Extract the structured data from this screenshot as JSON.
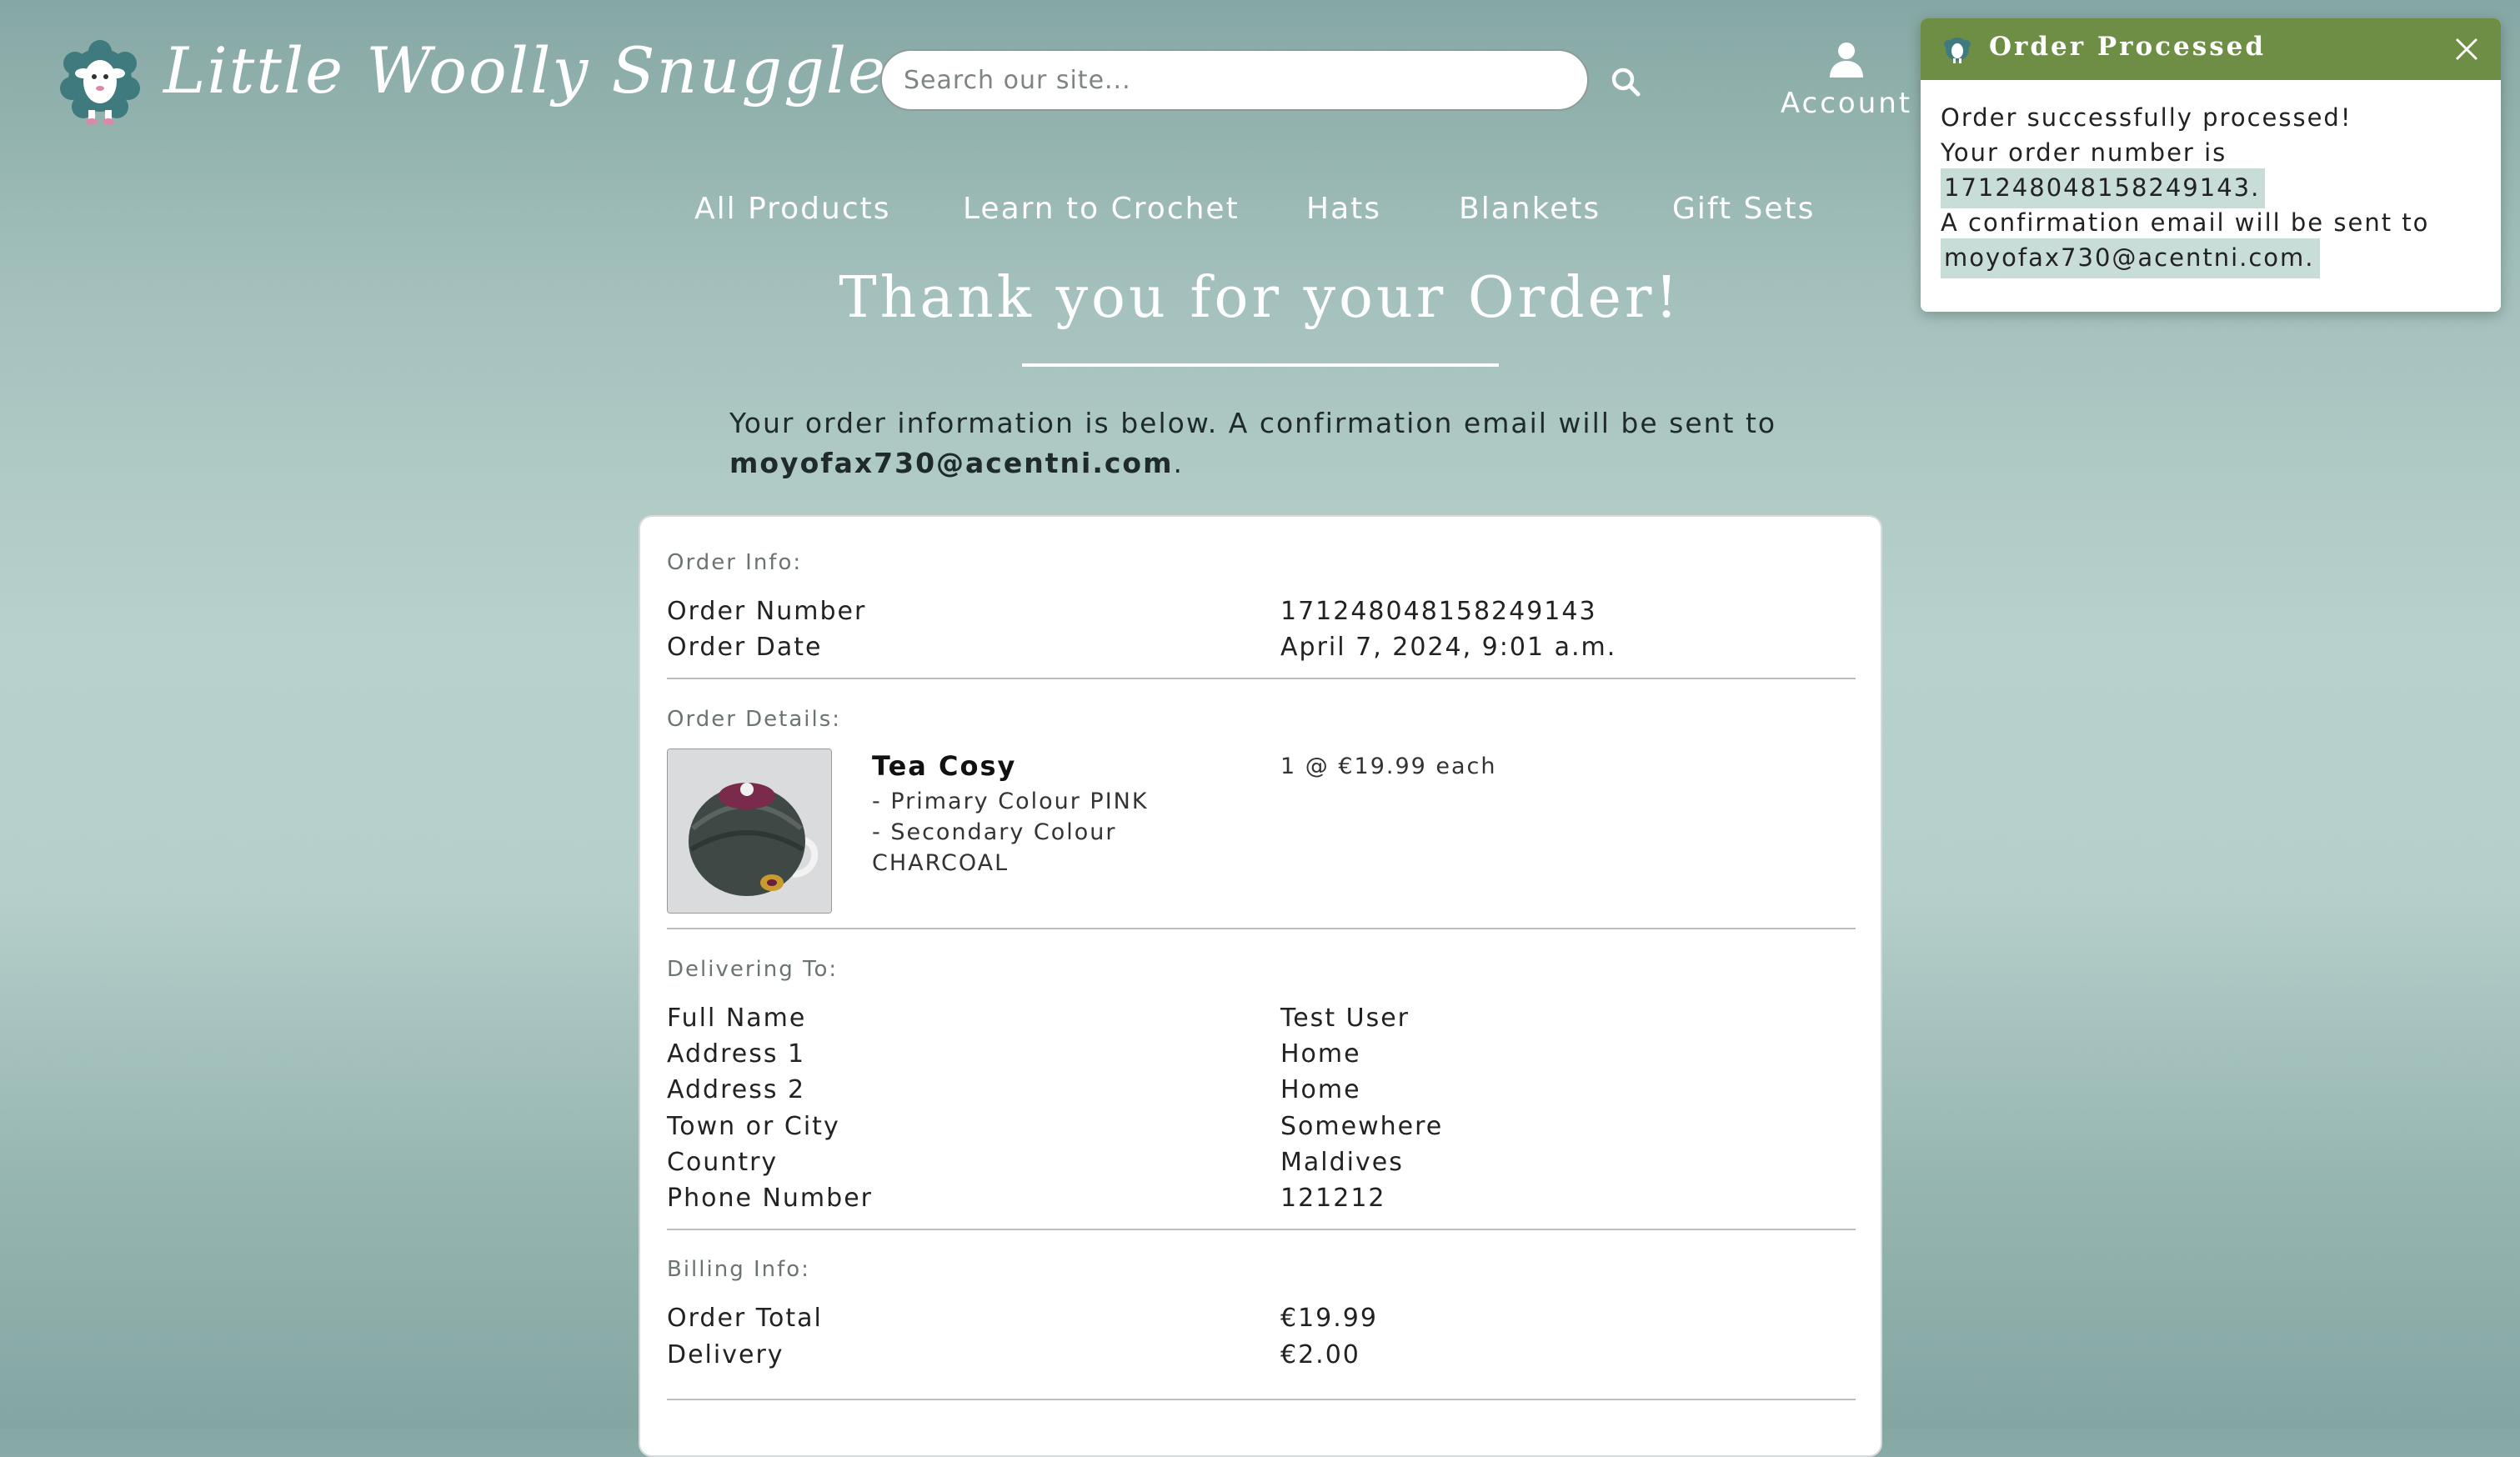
{
  "header": {
    "brand": "Little Woolly Snuggles",
    "search_placeholder": "Search our site...",
    "account_label": "Account"
  },
  "nav": {
    "items": [
      {
        "label": "All Products"
      },
      {
        "label": "Learn to Crochet"
      },
      {
        "label": "Hats"
      },
      {
        "label": "Blankets"
      },
      {
        "label": "Gift Sets"
      }
    ]
  },
  "page": {
    "title": "Thank you for your Order!",
    "intro_text": "Your order information is below. A confirmation email will be sent to",
    "intro_email": "moyofax730@acentni.com",
    "intro_period": "."
  },
  "order_info": {
    "heading": "Order Info:",
    "rows": [
      {
        "label": "Order Number",
        "value": "171248048158249143"
      },
      {
        "label": "Order Date",
        "value": "April 7, 2024, 9:01 a.m."
      }
    ]
  },
  "order_details": {
    "heading": "Order Details:",
    "item": {
      "name": "Tea Cosy",
      "attr1": "- Primary Colour PINK",
      "attr2": "- Secondary Colour",
      "attr3": "CHARCOAL",
      "qty_price": "1 @ €19.99 each"
    }
  },
  "delivering": {
    "heading": "Delivering To:",
    "rows": [
      {
        "label": "Full Name",
        "value": "Test User"
      },
      {
        "label": "Address 1",
        "value": "Home"
      },
      {
        "label": "Address 2",
        "value": "Home"
      },
      {
        "label": "Town or City",
        "value": "Somewhere"
      },
      {
        "label": "Country",
        "value": "Maldives"
      },
      {
        "label": "Phone Number",
        "value": "121212"
      }
    ]
  },
  "billing": {
    "heading": "Billing Info:",
    "rows": [
      {
        "label": "Order Total",
        "value": "€19.99"
      },
      {
        "label": "Delivery",
        "value": "€2.00"
      }
    ]
  },
  "toast": {
    "title": "Order Processed",
    "line1": "Order successfully processed!",
    "line2": "Your order number is",
    "order_number": "171248048158249143.",
    "line3": "A confirmation email will be sent to",
    "email": "moyofax730@acentni.com."
  },
  "colors": {
    "toast_header": "#6e8e46",
    "highlight": "#c8dcd8",
    "logo_teal": "#3f7b7e"
  }
}
